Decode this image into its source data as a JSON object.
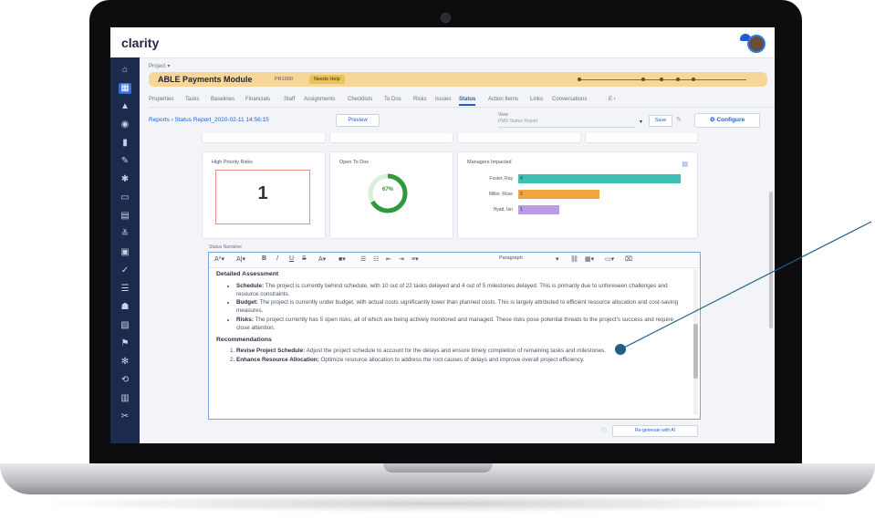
{
  "app": {
    "logo": "clarity"
  },
  "breadcrumb": "Project ▾",
  "project": {
    "title": "ABLE Payments Module",
    "id": "PR1000",
    "status": "Needs Help"
  },
  "tabs": [
    "Properties",
    "Tasks",
    "Baselines",
    "Financials",
    "Staff",
    "Assignments",
    "Checklists",
    "To Dos",
    "Risks",
    "Issues",
    "Status",
    "Action Items",
    "Links",
    "Conversations"
  ],
  "active_tab": "Status",
  "tabs_more": "E ›",
  "report": {
    "crumb": "Reports › Status Report_2020-02-11 14:56:15",
    "preview_label": "Preview",
    "view_label": "View",
    "view_value": "PMO Status Report",
    "save_label": "Save",
    "configure_label": "Configure"
  },
  "cards": {
    "risks": {
      "title": "High Priority Risks",
      "value": "1"
    },
    "todos": {
      "title": "Open To Dos",
      "value": "67%"
    },
    "managers": {
      "title": "Managers Impacted"
    }
  },
  "chart_data": {
    "type": "bar",
    "title": "Managers Impacted",
    "categories": [
      "Foster, Ray",
      "Miller, Rose",
      "Hyatt, Ian"
    ],
    "values": [
      4,
      2,
      1
    ],
    "colors": [
      "#3dbfb2",
      "#f0a640",
      "#b99be6"
    ]
  },
  "editor": {
    "label": "Status Narrative",
    "paragraph_select": "Paragraph",
    "heading1": "Detailed Assessment",
    "bullets": [
      {
        "title": "Schedule:",
        "text": "The project is currently behind schedule, with 10 out of 22 tasks delayed and 4 out of 5 milestones delayed. This is primarily due to unforeseen challenges and resource constraints."
      },
      {
        "title": "Budget:",
        "text": "The project is currently under budget, with actual costs significantly lower than planned costs. This is largely attributed to efficient resource allocation and cost-saving measures."
      },
      {
        "title": "Risks:",
        "text": "The project currently has 5 open risks, all of which are being actively monitored and managed. These risks pose potential threats to the project's success and require close attention."
      }
    ],
    "heading2": "Recommendations",
    "recommendations": [
      {
        "title": "Revise Project Schedule:",
        "text": "Adjust the project schedule to account for the delays and ensure timely completion of remaining tasks and milestones."
      },
      {
        "title": "Enhance Resource Allocation:",
        "text": "Optimize resource allocation to address the root causes of delays and improve overall project efficiency."
      }
    ]
  },
  "regenerate_label": "Re-generate with AI",
  "colors": {
    "accent": "#1f5fcf",
    "sidebar": "#1c2b4d",
    "project_bar": "#f7d699",
    "callout": "#1f5f8a"
  }
}
